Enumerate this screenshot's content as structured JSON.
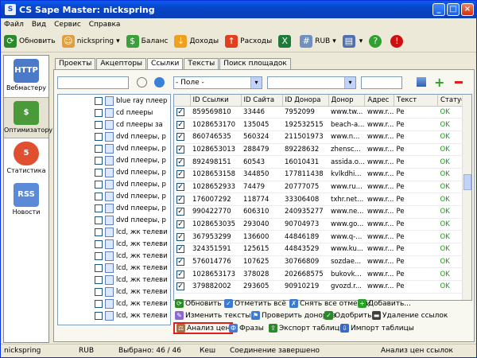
{
  "window": {
    "title": "CS Sape Master: nickspring"
  },
  "menu": [
    "Файл",
    "Вид",
    "Сервис",
    "Справка"
  ],
  "toolbar": {
    "refresh": "Обновить",
    "user": "nickspring",
    "balance": "Баланс",
    "income": "Доходы",
    "expenses": "Расходы",
    "currency": "RUB"
  },
  "sidebar": [
    {
      "label": "Вебмастеру",
      "icon": "http-hand-icon"
    },
    {
      "label": "Оптимизатору",
      "icon": "money-hand-icon"
    },
    {
      "label": "Статистика",
      "icon": "pie-chart-icon"
    },
    {
      "label": "Новости",
      "icon": "rss-icon"
    }
  ],
  "tabs": [
    "Проекты",
    "Акцепторы",
    "Ссылки",
    "Тексты",
    "Поиск площадок"
  ],
  "filter": {
    "field_placeholder": "- Поле -"
  },
  "tree": [
    "blue ray плеер",
    "cd плееры",
    "cd плееры за",
    "dvd плееры, р",
    "dvd плееры, р",
    "dvd плееры, р",
    "dvd плееры, р",
    "dvd плееры, р",
    "dvd плееры, р",
    "dvd плееры, р",
    "dvd плееры, р",
    "lcd, жк телеви",
    "lcd, жк телеви",
    "lcd, жк телеви",
    "lcd, жк телеви",
    "lcd, жк телеви",
    "lcd, жк телеви",
    "lcd, жк телеви",
    "lcd, жк телеви"
  ],
  "grid": {
    "columns": [
      "ID Ссылки",
      "ID Сайта",
      "ID Донора",
      "Донор",
      "Адрес",
      "Текст",
      "Статус"
    ],
    "rows": [
      [
        "859569810",
        "33446",
        "7952099",
        "www.tw...",
        "www.r...",
        "Pe",
        "OK"
      ],
      [
        "1028653170",
        "135045",
        "192532515",
        "beach-a...",
        "www.r...",
        "Pe",
        "OK"
      ],
      [
        "860746535",
        "560324",
        "211501973",
        "www.n...",
        "www.r...",
        "Pe",
        "OK"
      ],
      [
        "1028653013",
        "288479",
        "89228632",
        "zhensc...",
        "www.r...",
        "Pe",
        "OK"
      ],
      [
        "892498151",
        "60543",
        "16010431",
        "assida.o...",
        "www.r...",
        "Pe",
        "OK"
      ],
      [
        "1028653158",
        "344850",
        "177811438",
        "kvlkdhi...",
        "www.r...",
        "Pe",
        "OK"
      ],
      [
        "1028652933",
        "74479",
        "20777075",
        "www.ru...",
        "www.r...",
        "Pe",
        "OK"
      ],
      [
        "176007292",
        "118774",
        "33306408",
        "txhr.net...",
        "www.r...",
        "Pe",
        "OK"
      ],
      [
        "990422770",
        "606310",
        "240935277",
        "www.ne...",
        "www.r...",
        "Pe",
        "OK"
      ],
      [
        "1028653035",
        "293040",
        "90704973",
        "www.go...",
        "www.r...",
        "Pe",
        "OK"
      ],
      [
        "367953299",
        "136600",
        "44846189",
        "www.q-...",
        "www.r...",
        "Pe",
        "OK"
      ],
      [
        "324351591",
        "125615",
        "44843529",
        "www.ku...",
        "www.r...",
        "Pe",
        "OK"
      ],
      [
        "576014776",
        "107625",
        "30766809",
        "sozdae...",
        "www.r...",
        "Pe",
        "OK"
      ],
      [
        "1028653173",
        "378028",
        "202668575",
        "bukovk...",
        "www.r...",
        "Pe",
        "OK"
      ],
      [
        "379882002",
        "293605",
        "90910219",
        "gvozd.r...",
        "www.r...",
        "Pe",
        "OK"
      ]
    ]
  },
  "actions": {
    "refresh": "Обновить",
    "check_all": "Отметить всё",
    "uncheck_all": "Снять все отметки",
    "add": "Добавить...",
    "edit_texts": "Изменить тексты",
    "check_donors": "Проверить доноров",
    "approve": "Одобрить",
    "delete_links": "Удаление ссылок",
    "price_analysis": "Анализ цен",
    "phrases": "Фразы",
    "export_table": "Экспорт таблицы",
    "import_table": "Импорт таблицы"
  },
  "status": {
    "user": "nickspring",
    "currency": "RUB",
    "selected": "Выбрано: 46 / 46",
    "cache": "Кеш",
    "connection": "Соединение завершено",
    "task": "Анализ цен ссылок"
  }
}
